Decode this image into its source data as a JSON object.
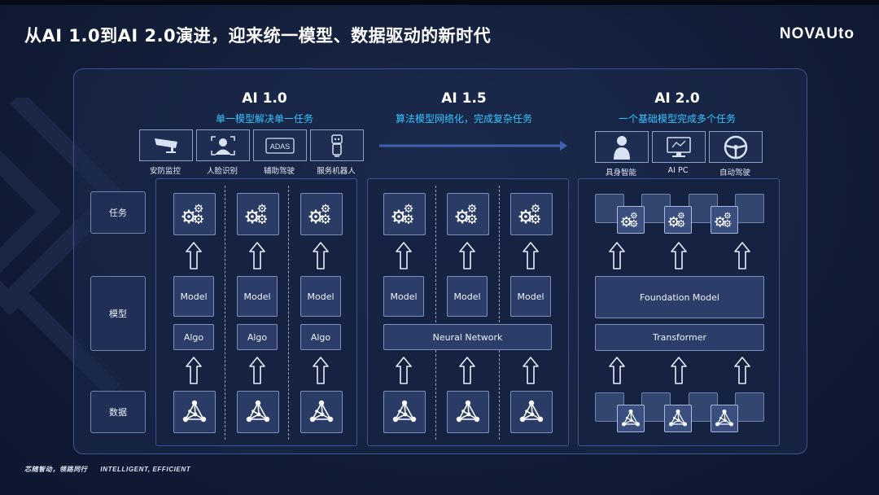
{
  "title": "从AI 1.0到AI 2.0演进，迎来统一模型、数据驱动的新时代",
  "logo": "NOVAUto",
  "footer": {
    "cn": "芯随智动，领路同行",
    "en": "INTELLIGENT, EFFICIENT"
  },
  "stages": [
    {
      "name": "AI 1.0",
      "subtitle": "单一模型解决单一任务"
    },
    {
      "name": "AI 1.5",
      "subtitle": "算法模型网络化，完成复杂任务"
    },
    {
      "name": "AI 2.0",
      "subtitle": "一个基础模型完成多个任务"
    }
  ],
  "apps_v1": [
    {
      "label": "安防监控",
      "icon": "cctv-camera-icon"
    },
    {
      "label": "人脸识别",
      "icon": "face-recognition-icon"
    },
    {
      "label": "辅助驾驶",
      "icon": "adas-icon",
      "badge": "ADAS"
    },
    {
      "label": "服务机器人",
      "icon": "service-robot-icon"
    }
  ],
  "apps_v2": [
    {
      "label": "具身智能",
      "icon": "humanoid-icon"
    },
    {
      "label": "AI PC",
      "icon": "ai-pc-icon"
    },
    {
      "label": "自动驾驶",
      "icon": "steering-wheel-icon"
    }
  ],
  "rows": {
    "task": "任务",
    "model": "模型",
    "data": "数据"
  },
  "labels": {
    "model": "Model",
    "algo": "Algo",
    "neural_network": "Neural Network",
    "foundation_model": "Foundation Model",
    "transformer": "Transformer"
  },
  "colors": {
    "accent": "#34c7ff",
    "background": "#121d38",
    "panel_border": "#3a5690"
  }
}
